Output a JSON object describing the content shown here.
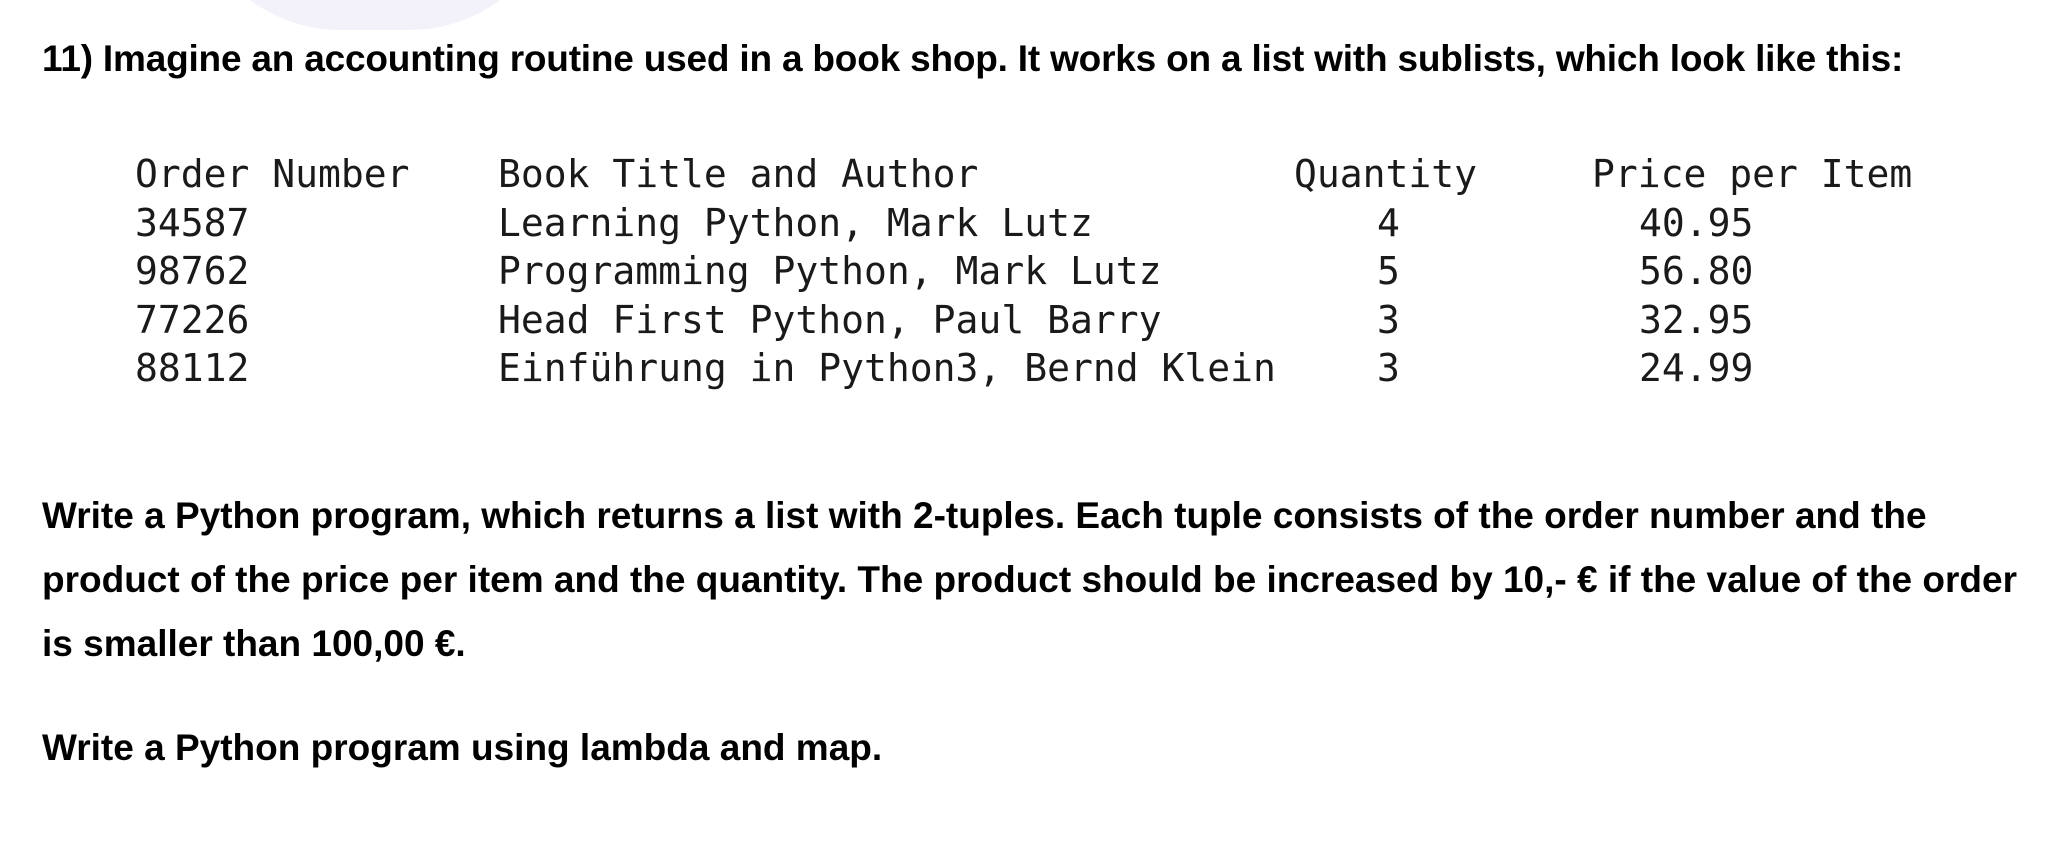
{
  "heading": "11) Imagine an accounting routine used in a book shop. It works on a list with sublists, which look like this:",
  "table": {
    "headers": {
      "order": "Order Number",
      "title": "Book Title and Author",
      "quantity": "Quantity",
      "price": "Price per Item"
    },
    "rows": [
      {
        "order": "34587",
        "title": "Learning Python, Mark Lutz",
        "quantity": "4",
        "price": "40.95"
      },
      {
        "order": "98762",
        "title": "Programming Python, Mark Lutz",
        "quantity": "5",
        "price": "56.80"
      },
      {
        "order": "77226",
        "title": "Head First Python, Paul Barry",
        "quantity": "3",
        "price": "32.95"
      },
      {
        "order": "88112",
        "title": "Einführung in Python3, Bernd Klein",
        "quantity": "3",
        "price": "24.99"
      }
    ]
  },
  "paragraphs": [
    "Write a Python program, which returns a list with 2-tuples. Each tuple consists of the order number and the product of the price per item and the quantity. The product should be increased by 10,- € if the value of the order is smaller than 100,00 €.",
    "Write a Python program using lambda and map."
  ]
}
